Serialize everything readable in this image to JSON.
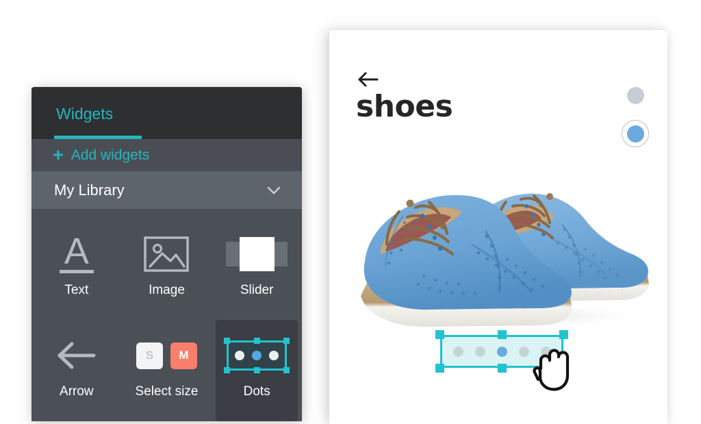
{
  "sidebar": {
    "tab": {
      "label": "Widgets"
    },
    "add_widgets": {
      "plus": "+",
      "label": "Add widgets"
    },
    "library": {
      "label": "My Library",
      "chevron_icon": "chevron-down-icon"
    },
    "widgets": [
      {
        "label": "Text",
        "icon": "text-a-icon",
        "selected": false
      },
      {
        "label": "Image",
        "icon": "image-icon",
        "selected": false
      },
      {
        "label": "Slider",
        "icon": "slider-icon",
        "selected": false
      },
      {
        "label": "Arrow",
        "icon": "arrow-left-icon",
        "selected": false
      },
      {
        "label": "Select size",
        "icon": "size-chips-icon",
        "selected": false
      },
      {
        "label": "Dots",
        "icon": "dots-icon",
        "selected": true
      }
    ],
    "size_chips": [
      {
        "label": "S",
        "state": "unselected"
      },
      {
        "label": "M",
        "state": "selected"
      }
    ],
    "colors": {
      "accent": "#23b6bd",
      "header_bg": "#2d2f31",
      "add_row_bg": "#4a4e54",
      "library_bg": "#5e646b",
      "grid_bg": "#4b4f56",
      "selected_cell_bg": "#3b3e44",
      "chip_m": "#f87f6c"
    }
  },
  "preview": {
    "back_icon": "arrow-left-icon",
    "title": "shoes",
    "product_image": "blue-suede-wingtip-shoes",
    "swatches": [
      {
        "name": "gray",
        "color": "#c7cdd6",
        "selected": false
      },
      {
        "name": "blue",
        "color": "#6aaade",
        "selected": true
      }
    ],
    "dots_widget": {
      "dot_count": 5,
      "active_index": 2,
      "inactive_color": "#c6d4d6",
      "active_color": "#6aaade",
      "selection_color": "#1fc0cc",
      "selected": true,
      "handles": [
        "top-left",
        "top-center",
        "top-right",
        "bottom-left",
        "bottom-center",
        "bottom-right"
      ]
    },
    "cursor": "hand-cursor"
  }
}
